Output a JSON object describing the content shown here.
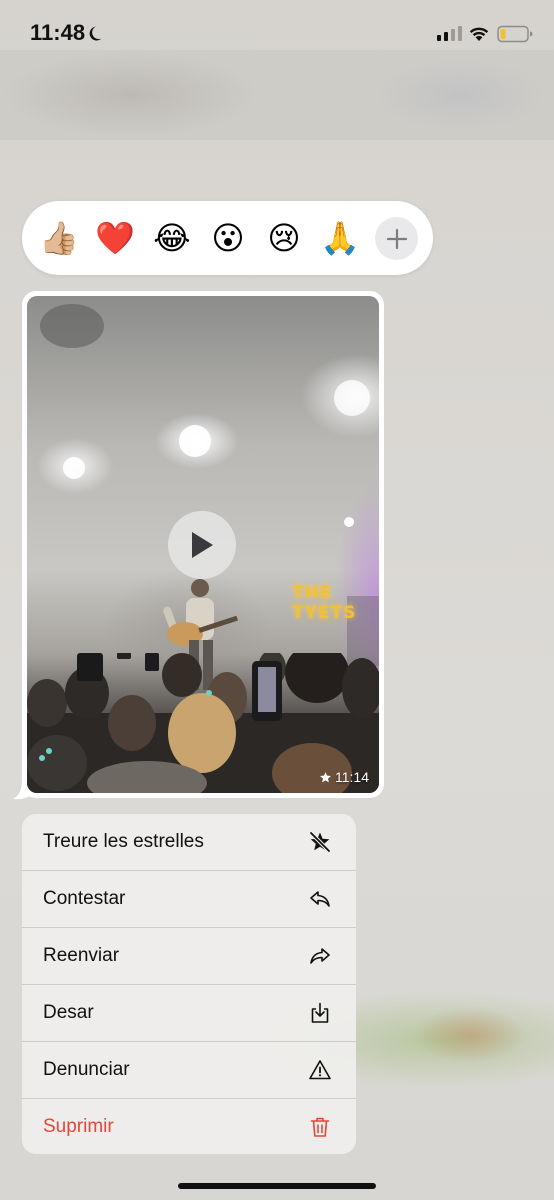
{
  "status_bar": {
    "time": "11:48",
    "icons": [
      "moon-icon",
      "cellular-signal-icon",
      "wifi-icon",
      "battery-icon"
    ]
  },
  "reactions": {
    "emojis": [
      {
        "name": "thumbs-up",
        "glyph": "👍🏼"
      },
      {
        "name": "heart",
        "glyph": "❤️"
      },
      {
        "name": "tears-of-joy",
        "glyph": "😂"
      },
      {
        "name": "surprised",
        "glyph": "😮"
      },
      {
        "name": "crying",
        "glyph": "😢"
      },
      {
        "name": "pray",
        "glyph": "🙏"
      }
    ],
    "more_icon": "plus-icon"
  },
  "message": {
    "type": "video",
    "timestamp": "11:14",
    "starred": true,
    "video_sign_text": "THE TYETS",
    "play_icon": "play-icon"
  },
  "context_menu": {
    "items": [
      {
        "label": "Treure les estrelles",
        "icon": "unstar-icon",
        "destructive": false
      },
      {
        "label": "Contestar",
        "icon": "reply-icon",
        "destructive": false
      },
      {
        "label": "Reenviar",
        "icon": "forward-icon",
        "destructive": false
      },
      {
        "label": "Desar",
        "icon": "save-icon",
        "destructive": false
      },
      {
        "label": "Denunciar",
        "icon": "warning-icon",
        "destructive": false
      },
      {
        "label": "Suprimir",
        "icon": "trash-icon",
        "destructive": true
      }
    ]
  },
  "colors": {
    "destructive": "#e5463a",
    "menu_background": "#eeedeb",
    "reaction_bar_background": "#ffffff"
  }
}
